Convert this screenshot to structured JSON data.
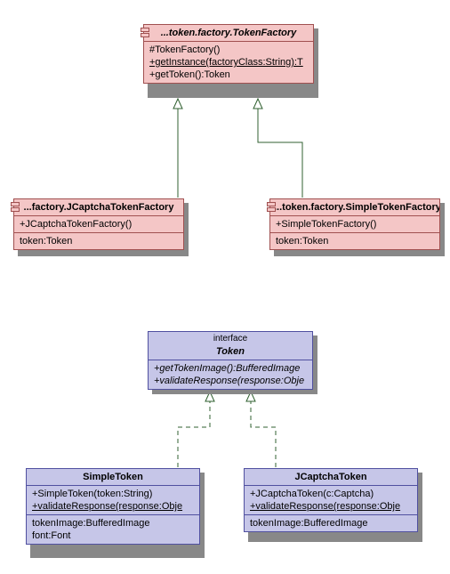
{
  "classes": {
    "tokenFactory": {
      "name": "...token.factory.TokenFactory",
      "members": {
        "m1": "#TokenFactory()",
        "m2": "+getInstance(factoryClass:String):T",
        "m3": "+getToken():Token"
      }
    },
    "jcaptchaTokenFactory": {
      "name": "...factory.JCaptchaTokenFactory",
      "members": {
        "m1": "+JCaptchaTokenFactory()",
        "m2": "token:Token"
      }
    },
    "simpleTokenFactory": {
      "name": "...token.factory.SimpleTokenFactory",
      "members": {
        "m1": "+SimpleTokenFactory()",
        "m2": "token:Token"
      }
    },
    "tokenInterface": {
      "stereotype": "interface",
      "name": "Token",
      "members": {
        "m1": "+getTokenImage():BufferedImage",
        "m2": "+validateResponse(response:Obje"
      }
    },
    "simpleToken": {
      "name": "SimpleToken",
      "members": {
        "m1": "+SimpleToken(token:String)",
        "m2": "+validateResponse(response:Obje",
        "m3": "tokenImage:BufferedImage",
        "m4": "font:Font"
      }
    },
    "jcaptchaToken": {
      "name": "JCaptchaToken",
      "members": {
        "m1": "+JCaptchaToken(c:Captcha)",
        "m2": "+validateResponse(response:Obje",
        "m3": "tokenImage:BufferedImage"
      }
    }
  },
  "colors": {
    "pinkFill": "#f4c6c6",
    "blueFill": "#c6c6e8",
    "pinkBorder": "#a05050",
    "blueBorder": "#5050a0",
    "shadow": "#888888",
    "connector": "#306030"
  },
  "connections": [
    {
      "from": "jcaptchaTokenFactory",
      "to": "tokenFactory",
      "type": "generalization",
      "style": "solid"
    },
    {
      "from": "simpleTokenFactory",
      "to": "tokenFactory",
      "type": "generalization",
      "style": "solid"
    },
    {
      "from": "simpleToken",
      "to": "tokenInterface",
      "type": "realization",
      "style": "dashed"
    },
    {
      "from": "jcaptchaToken",
      "to": "tokenInterface",
      "type": "realization",
      "style": "dashed"
    }
  ]
}
